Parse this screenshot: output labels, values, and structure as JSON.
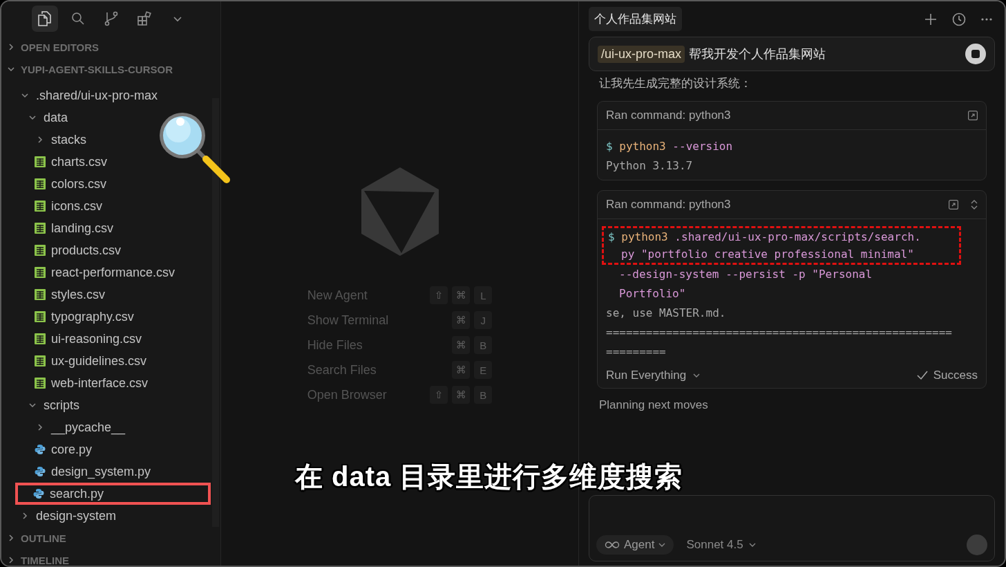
{
  "sidebar": {
    "toolbar": [
      {
        "kind": "files",
        "selected": true
      },
      {
        "kind": "search",
        "selected": false
      },
      {
        "kind": "source-control",
        "selected": false
      },
      {
        "kind": "extensions",
        "selected": false
      },
      {
        "kind": "more",
        "selected": false
      }
    ],
    "sections": [
      {
        "label": "OPEN EDITORS",
        "expanded": false
      },
      {
        "label": "YUPI-AGENT-SKILLS-CURSOR",
        "expanded": true,
        "tree": [
          {
            "name": ".shared/ui-ux-pro-max",
            "kind": "folder",
            "expanded": true,
            "children": [
              {
                "name": "data",
                "kind": "folder",
                "expanded": true,
                "children": [
                  {
                    "name": "stacks",
                    "kind": "folder",
                    "expanded": false
                  },
                  {
                    "name": "charts.csv",
                    "kind": "csv"
                  },
                  {
                    "name": "colors.csv",
                    "kind": "csv"
                  },
                  {
                    "name": "icons.csv",
                    "kind": "csv"
                  },
                  {
                    "name": "landing.csv",
                    "kind": "csv"
                  },
                  {
                    "name": "products.csv",
                    "kind": "csv"
                  },
                  {
                    "name": "react-performance.csv",
                    "kind": "csv"
                  },
                  {
                    "name": "styles.csv",
                    "kind": "csv"
                  },
                  {
                    "name": "typography.csv",
                    "kind": "csv"
                  },
                  {
                    "name": "ui-reasoning.csv",
                    "kind": "csv"
                  },
                  {
                    "name": "ux-guidelines.csv",
                    "kind": "csv"
                  },
                  {
                    "name": "web-interface.csv",
                    "kind": "csv"
                  }
                ]
              },
              {
                "name": "scripts",
                "kind": "folder",
                "expanded": true,
                "children": [
                  {
                    "name": "__pycache__",
                    "kind": "folder",
                    "expanded": false
                  },
                  {
                    "name": "core.py",
                    "kind": "py"
                  },
                  {
                    "name": "design_system.py",
                    "kind": "py"
                  },
                  {
                    "name": "search.py",
                    "kind": "py",
                    "outlined": true
                  }
                ]
              }
            ]
          },
          {
            "name": "design-system",
            "kind": "folder",
            "expanded": false
          }
        ]
      },
      {
        "label": "OUTLINE",
        "expanded": false
      },
      {
        "label": "TIMELINE",
        "expanded": false
      }
    ]
  },
  "welcome": {
    "shortcuts": [
      {
        "label": "New Agent",
        "keys": [
          "⇧",
          "⌘",
          "L"
        ]
      },
      {
        "label": "Show Terminal",
        "keys": [
          "⌘",
          "J"
        ]
      },
      {
        "label": "Hide Files",
        "keys": [
          "⌘",
          "B"
        ]
      },
      {
        "label": "Search Files",
        "keys": [
          "⌘",
          "E"
        ]
      },
      {
        "label": "Open Browser",
        "keys": [
          "⇧",
          "⌘",
          "B"
        ]
      }
    ]
  },
  "chat": {
    "title": "个人作品集网站",
    "prompt": {
      "command": "/ui-ux-pro-max",
      "text": "帮我开发个人作品集网站"
    },
    "messages": [
      {
        "kind": "text",
        "text": "让我先生成完整的设计系统："
      },
      {
        "kind": "command",
        "title": "Ran command: python3",
        "collapsible": false,
        "command": {
          "prompt": "$",
          "program": "python3",
          "lines": [
            "--version"
          ]
        },
        "output": [
          "Python 3.13.7"
        ]
      },
      {
        "kind": "command",
        "title": "Ran command: python3",
        "collapsible": true,
        "command": {
          "prompt": "$",
          "program": "python3",
          "outlined": true,
          "lines": [
            ".shared/ui-ux-pro-max/scripts/search.",
            "py \"portfolio creative professional minimal\"",
            "--design-system --persist -p \"Personal",
            "Portfolio\""
          ]
        },
        "output": [
          "se, use MASTER.md.",
          "====================================================",
          "========="
        ],
        "footer": {
          "mode": "Run Everything",
          "status": "Success"
        }
      },
      {
        "kind": "status",
        "text": "Planning next moves"
      }
    ],
    "composer": {
      "mode": "Agent",
      "model": "Sonnet 4.5"
    }
  },
  "subtitle": "在 data 目录里进行多维度搜索"
}
